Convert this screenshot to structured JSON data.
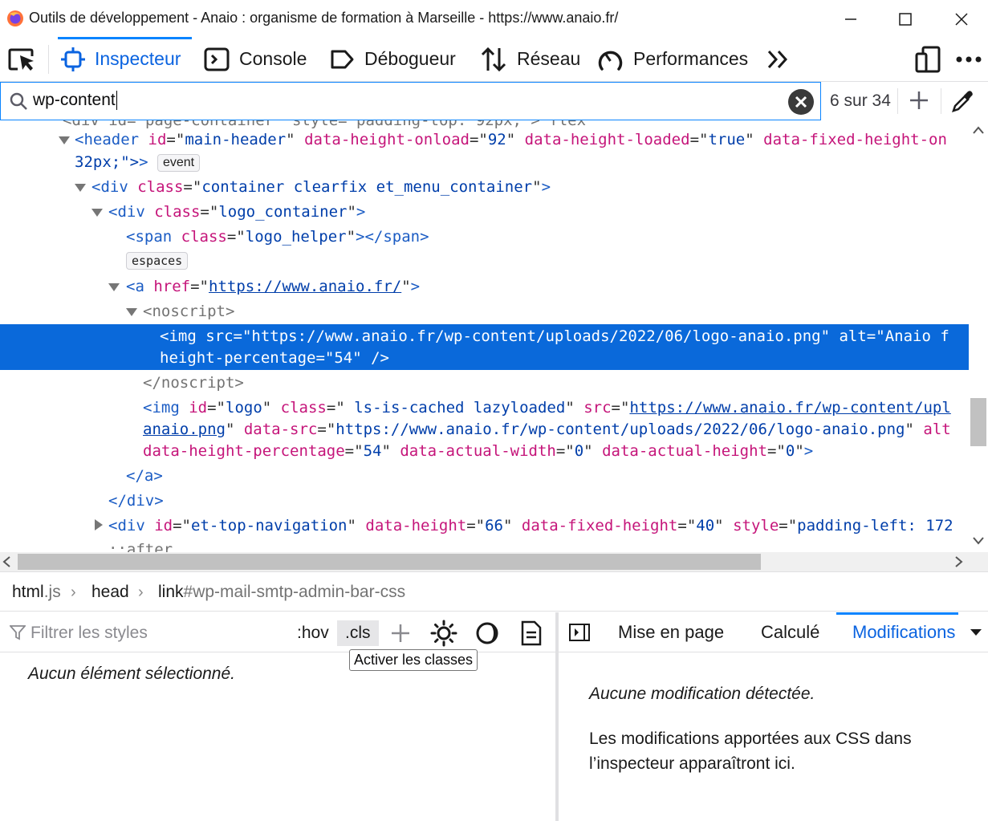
{
  "window": {
    "title": "Outils de développement - Anaio : organisme de formation à Marseille - https://www.anaio.fr/",
    "controls": [
      "minimize",
      "maximize",
      "close"
    ]
  },
  "toolbar": {
    "tabs": [
      {
        "label": "Inspecteur",
        "icon": "inspector-icon",
        "active": true
      },
      {
        "label": "Console",
        "icon": "console-icon",
        "active": false
      },
      {
        "label": "Débogueur",
        "icon": "debugger-icon",
        "active": false
      },
      {
        "label": "Réseau",
        "icon": "network-icon",
        "active": false
      },
      {
        "label": "Performances",
        "icon": "performance-icon",
        "active": false
      }
    ]
  },
  "search": {
    "value": "wp-content",
    "count": "6 sur 34"
  },
  "markup": {
    "partial_top": "<div id=\"page-container\" style=\"padding-top: 92px;\"> flex",
    "header_open": {
      "tag": "header",
      "id": "main-header",
      "data_height_onload": "92",
      "data_height_loaded": "true",
      "data_fixed_height_on": "data-fixed-height-on"
    },
    "header_cont": "32px;\">",
    "event_badge": "event",
    "div_container_class": "container clearfix et_menu_container",
    "div_logo_class": "logo_container",
    "span_class": "logo_helper",
    "espaces_badge": "espaces",
    "a_href": "https://www.anaio.fr/",
    "noscript": "noscript",
    "selected_l1_src": "https://www.anaio.fr/wp-content/uploads/2022/06/logo-anaio.png",
    "selected_l1_alt": "Anaio f",
    "selected_l2": "height-percentage=\"54\" />",
    "img_id": "logo",
    "img_class": " ls-is-cached lazyloaded",
    "img_src": "https://www.anaio.fr/wp-content/upl",
    "img_l2_link": "anaio.png",
    "img_l2_datasrc": "https://www.anaio.fr/wp-content/uploads/2022/06/logo-anaio.png",
    "img_l2_tail": "alt",
    "img_l3_hp": "54",
    "img_l3_aw": "0",
    "img_l3_ah": "0",
    "topnav_id": "et-top-navigation",
    "topnav_dh": "66",
    "topnav_dfh": "40",
    "topnav_style": "padding-left: 172",
    "after": "::after"
  },
  "breadcrumbs": [
    {
      "main": "html",
      "faint": ".js"
    },
    {
      "main": "head",
      "faint": ""
    },
    {
      "main": "link",
      "faint": "#wp-mail-smtp-admin-bar-css"
    }
  ],
  "rules": {
    "filter_placeholder": "Filtrer les styles",
    "hov": ":hov",
    "cls": ".cls",
    "tooltip": "Activer les classes",
    "empty": "Aucun élément sélectionné."
  },
  "sidepanel": {
    "tabs": [
      "Mise en page",
      "Calculé",
      "Modifications"
    ],
    "active_tab": "Modifications",
    "no_changes": "Aucune modification détectée.",
    "description": "Les modifications apportées aux CSS dans l’inspecteur apparaîtront ici."
  },
  "colors": {
    "accent": "#0a84ff",
    "selection": "#0a69da",
    "tag": "#1b5cc4",
    "attribute": "#c5157a"
  }
}
